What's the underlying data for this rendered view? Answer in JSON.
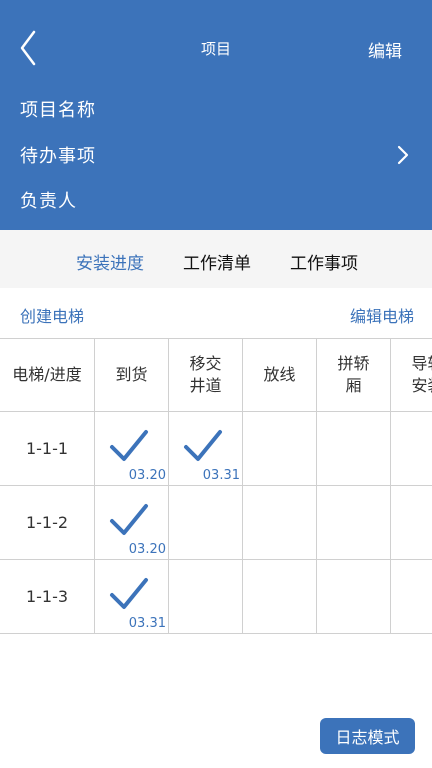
{
  "header": {
    "title": "项目",
    "edit_label": "编辑",
    "rows": [
      "项目名称",
      "待办事项",
      "负责人"
    ]
  },
  "tabs": [
    {
      "label": "安装进度",
      "active": true
    },
    {
      "label": "工作清单",
      "active": false
    },
    {
      "label": "工作事项",
      "active": false
    }
  ],
  "actions": {
    "create": "创建电梯",
    "edit": "编辑电梯"
  },
  "table": {
    "columns": [
      "电梯/进度",
      "到货",
      "移交\n井道",
      "放线",
      "拼轿\n厢",
      "导轨\n安装"
    ],
    "rows": [
      {
        "label": "1-1-1",
        "cells": [
          {
            "done": true,
            "date": "03.20"
          },
          {
            "done": true,
            "date": "03.31"
          },
          {},
          {},
          {}
        ]
      },
      {
        "label": "1-1-2",
        "cells": [
          {
            "done": true,
            "date": "03.20"
          },
          {},
          {},
          {},
          {}
        ]
      },
      {
        "label": "1-1-3",
        "cells": [
          {
            "done": true,
            "date": "03.31"
          },
          {},
          {},
          {},
          {}
        ]
      }
    ]
  },
  "bottom": {
    "log_mode": "日志模式"
  },
  "colors": {
    "accent": "#3c73ba",
    "grid": "#d0d0d0",
    "tab_bar": "#f5f5f5"
  }
}
